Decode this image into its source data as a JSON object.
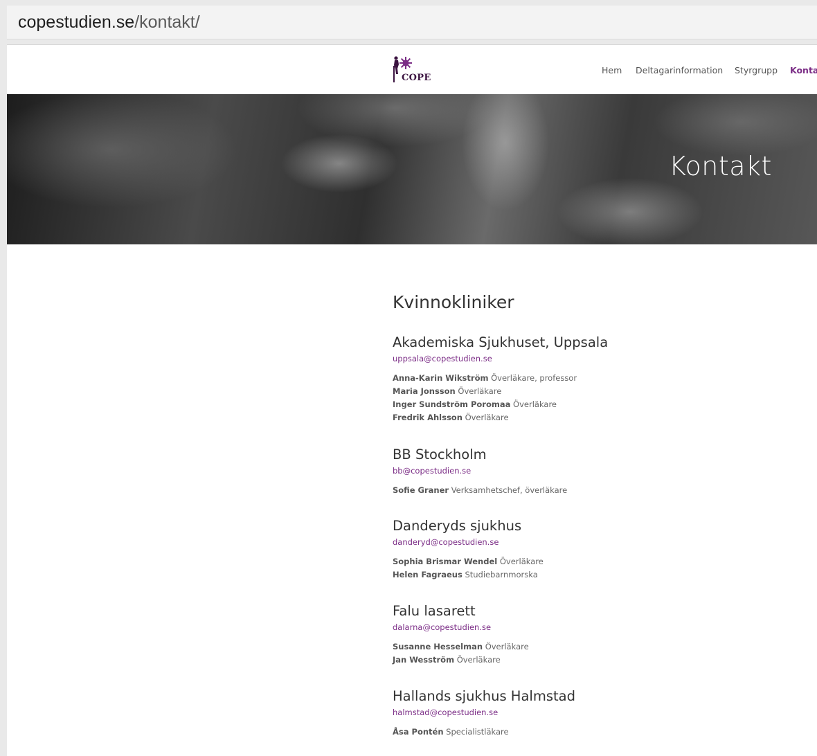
{
  "browser": {
    "url_host": "copestudien.se",
    "url_path": "/kontakt/"
  },
  "site": {
    "logo_text": "COPE",
    "nav": [
      "Hem",
      "Deltagarinformation",
      "Styrgrupp",
      "Kontakt"
    ],
    "active_nav": "Kontakt",
    "accent_color": "#7b2d86"
  },
  "hero": {
    "title": "Kontakt"
  },
  "main": {
    "section_title": "Kvinnokliniker",
    "clinics": [
      {
        "name": "Akademiska Sjukhuset, Uppsala",
        "email": "uppsala@copestudien.se",
        "staff": [
          {
            "name": "Anna-Karin Wikström",
            "role": "Överläkare, professor"
          },
          {
            "name": "Maria Jonsson",
            "role": "Överläkare"
          },
          {
            "name": "Inger Sundström Poromaa",
            "role": "Överläkare"
          },
          {
            "name": "Fredrik Ahlsson",
            "role": "Överläkare"
          }
        ]
      },
      {
        "name": "BB Stockholm",
        "email": "bb@copestudien.se",
        "staff": [
          {
            "name": "Sofie Graner",
            "role": "Verksamhetschef, överläkare"
          }
        ]
      },
      {
        "name": "Danderyds sjukhus",
        "email": "danderyd@copestudien.se",
        "staff": [
          {
            "name": "Sophia Brismar Wendel",
            "role": "Överläkare"
          },
          {
            "name": "Helen Fagraeus",
            "role": "Studiebarnmorska"
          }
        ]
      },
      {
        "name": "Falu lasarett",
        "email": "dalarna@copestudien.se",
        "staff": [
          {
            "name": "Susanne Hesselman",
            "role": "Överläkare"
          },
          {
            "name": "Jan Wesström",
            "role": "Överläkare"
          }
        ]
      },
      {
        "name": "Hallands sjukhus Halmstad",
        "email": "halmstad@copestudien.se",
        "staff": [
          {
            "name": "Åsa Pontén",
            "role": "Specialistläkare"
          }
        ]
      }
    ]
  }
}
